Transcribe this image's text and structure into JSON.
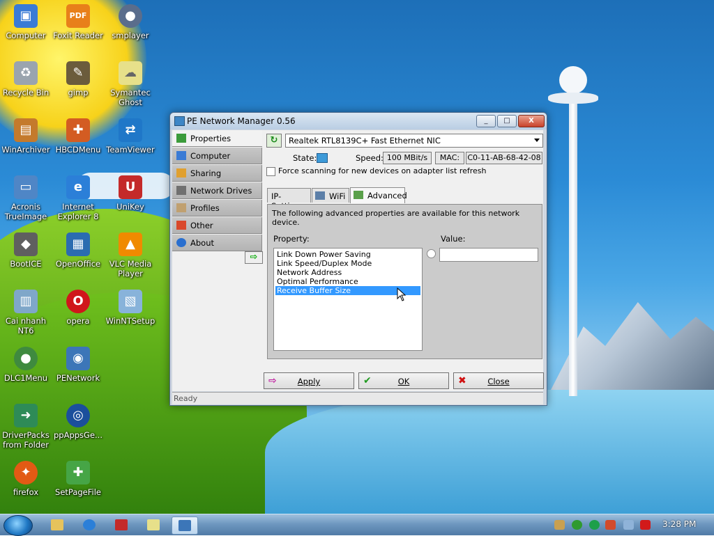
{
  "desktop": {
    "icons": [
      {
        "label": "Computer",
        "icon": "computer-icon",
        "color": "#3a7bd5"
      },
      {
        "label": "Foxit Reader",
        "icon": "foxit-reader-icon",
        "color": "#e8801a"
      },
      {
        "label": "smplayer",
        "icon": "smplayer-icon",
        "color": "#5a6d8c"
      },
      {
        "label": "Recycle Bin",
        "icon": "recycle-bin-icon",
        "color": "#9aa4ae"
      },
      {
        "label": "gimp",
        "icon": "gimp-icon",
        "color": "#6b5c3c"
      },
      {
        "label": "Symantec Ghost",
        "icon": "symantec-ghost-icon",
        "color": "#e7e08a"
      },
      {
        "label": "WinArchiver",
        "icon": "winarchiver-icon",
        "color": "#c47a2c"
      },
      {
        "label": "HBCDMenu",
        "icon": "hbcdmenu-icon",
        "color": "#d35c22"
      },
      {
        "label": "TeamViewer",
        "icon": "teamviewer-icon",
        "color": "#1f77c8"
      },
      {
        "label": "Acronis TrueImage",
        "icon": "acronis-icon",
        "color": "#4f86c6"
      },
      {
        "label": "Internet Explorer 8",
        "icon": "internet-explorer-icon",
        "color": "#2b7fd8"
      },
      {
        "label": "UniKey",
        "icon": "unikey-icon",
        "color": "#c42a2a"
      },
      {
        "label": "BootICE",
        "icon": "bootice-icon",
        "color": "#5f5f5f"
      },
      {
        "label": "OpenOffice",
        "icon": "openoffice-icon",
        "color": "#2b6cb0"
      },
      {
        "label": "VLC Media Player",
        "icon": "vlc-icon",
        "color": "#f08a00"
      },
      {
        "label": "Cai nhanh NT6",
        "icon": "cai-nhanh-icon",
        "color": "#7fa7c9"
      },
      {
        "label": "opera",
        "icon": "opera-icon",
        "color": "#d0161b"
      },
      {
        "label": "WinNTSetup",
        "icon": "winntsetup-icon",
        "color": "#88b3da"
      },
      {
        "label": "DLC1Menu",
        "icon": "dlc1menu-icon",
        "color": "#3f8a3f"
      },
      {
        "label": "PENetwork",
        "icon": "penetwork-icon",
        "color": "#3c76b8"
      },
      {
        "label": "DriverPacks from Folder",
        "icon": "driverpacks-icon",
        "color": "#2e8b57"
      },
      {
        "label": "ppAppsGe...",
        "icon": "ppappsge-icon",
        "color": "#1b4f9c"
      },
      {
        "label": "firefox",
        "icon": "firefox-icon",
        "color": "#e25a14"
      },
      {
        "label": "SetPageFile",
        "icon": "setpagefile-icon",
        "color": "#46a546"
      }
    ]
  },
  "window": {
    "title": "PE Network Manager 0.56",
    "buttons": {
      "minimize": "_",
      "maximize": "□",
      "close": "X"
    },
    "nav": [
      {
        "label": "Properties",
        "icon": "properties-icon",
        "color": "#3b9b3b",
        "selected": true
      },
      {
        "label": "Computer",
        "icon": "computer-icon",
        "color": "#3a7bd5",
        "selected": false
      },
      {
        "label": "Sharing",
        "icon": "sharing-icon",
        "color": "#e0a030",
        "selected": false
      },
      {
        "label": "Network Drives",
        "icon": "network-drives-icon",
        "color": "#707070",
        "selected": false
      },
      {
        "label": "Profiles",
        "icon": "profiles-icon",
        "color": "#c0a070",
        "selected": false
      },
      {
        "label": "Other",
        "icon": "other-icon",
        "color": "#d9482b",
        "selected": false
      },
      {
        "label": "About",
        "icon": "help-icon",
        "color": "#2a6fcf",
        "selected": false
      }
    ],
    "nav_arrow": "⇨",
    "adapter": {
      "selected": "Realtek RTL8139C+ Fast Ethernet NIC",
      "refresh_glyph": "↻"
    },
    "state_label": "State:",
    "speed_label": "Speed:",
    "speed_value": "100 MBit/s",
    "mac_label": "MAC:",
    "mac_value": "C0-11-AB-68-42-08",
    "force_scan_label": "Force scanning for new devices on adapter list refresh",
    "force_scan_checked": false,
    "tabs": [
      {
        "label": "IP-Settings",
        "selected": false
      },
      {
        "label": "WiFi",
        "icon": "wifi-icon",
        "selected": false
      },
      {
        "label": "Advanced",
        "icon": "advanced-icon",
        "selected": true
      }
    ],
    "advanced": {
      "description": "The following advanced properties are available for this network device.",
      "property_label": "Property:",
      "value_label": "Value:",
      "properties": [
        {
          "label": "Link Down Power Saving",
          "selected": false
        },
        {
          "label": "Link Speed/Duplex Mode",
          "selected": false
        },
        {
          "label": "Network Address",
          "selected": false
        },
        {
          "label": "Optimal Performance",
          "selected": false
        },
        {
          "label": "Receive Buffer Size",
          "selected": true
        }
      ],
      "value": ""
    },
    "actions": {
      "apply": {
        "label": "Apply",
        "glyph": "⇨",
        "color": "#c020a0"
      },
      "ok": {
        "label": "OK",
        "glyph": "✔",
        "color": "#1f9a1f"
      },
      "close": {
        "label": "Close",
        "glyph": "✖",
        "color": "#d01010"
      }
    },
    "status": "Ready"
  },
  "taskbar": {
    "clock": "3:28 PM",
    "pinned": [
      {
        "icon": "explorer-icon",
        "color": "#e6c35c",
        "active": false
      },
      {
        "icon": "internet-explorer-icon",
        "color": "#2b7fd8",
        "active": false
      },
      {
        "icon": "unikey-icon",
        "color": "#c42a2a",
        "active": false
      },
      {
        "icon": "symantec-ghost-icon",
        "color": "#e7e08a",
        "active": false
      },
      {
        "icon": "penetwork-icon",
        "color": "#3c76b8",
        "active": true
      }
    ],
    "tray": [
      {
        "icon": "tray-tools-icon",
        "color": "#c9a050"
      },
      {
        "icon": "tray-check-icon",
        "color": "#2f9a2f"
      },
      {
        "icon": "tray-play-icon",
        "color": "#1d9f4a"
      },
      {
        "icon": "tray-ghost-icon",
        "color": "#d24b2b"
      },
      {
        "icon": "tray-network-icon",
        "color": "#8fb3d9"
      },
      {
        "icon": "tray-volume-icon",
        "color": "#d21a1a"
      }
    ]
  }
}
